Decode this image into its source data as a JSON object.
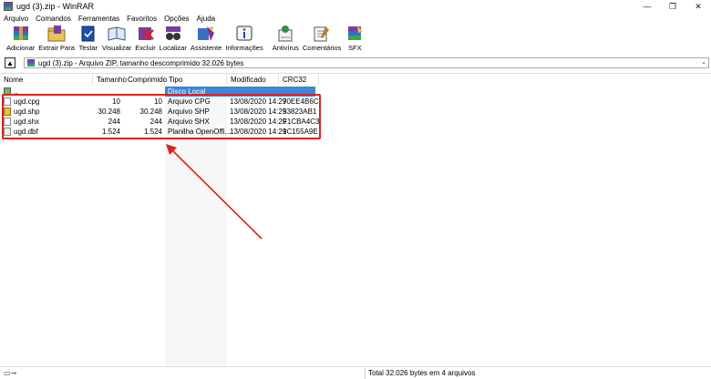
{
  "window": {
    "title": "ugd (3).zip - WinRAR",
    "minimize": "—",
    "restore": "❐",
    "close": "✕"
  },
  "menu": [
    "Arquivo",
    "Comandos",
    "Ferramentas",
    "Favoritos",
    "Opções",
    "Ajuda"
  ],
  "toolbar": {
    "buttons": [
      "Adicionar",
      "Extrair Para",
      "Testar",
      "Visualizar",
      "Excluir",
      "Localizar",
      "Assistente",
      "Informações",
      "Antivírus",
      "Comentários",
      "SFX"
    ]
  },
  "address": {
    "text": "ugd (3).zip - Arquivo ZIP, tamanho descomprimido 32.026 bytes",
    "up_glyph": "▲",
    "dropdown_glyph": "⌄"
  },
  "columns": {
    "name": "Nome",
    "size": "Tamanho",
    "compressed": "Comprimido",
    "type": "Tipo",
    "modified": "Modificado",
    "crc": "CRC32"
  },
  "parent_row": {
    "name": "..",
    "type": "Disco Local"
  },
  "files": [
    {
      "name": "ugd.cpg",
      "size": "10",
      "compressed": "10",
      "type": "Arquivo CPG",
      "modified": "13/08/2020 14:29",
      "crc": "70EE4B6C"
    },
    {
      "name": "ugd.shp",
      "size": "30.248",
      "compressed": "30.248",
      "type": "Arquivo SHP",
      "modified": "13/08/2020 14:29",
      "crc": "53823AB1"
    },
    {
      "name": "ugd.shx",
      "size": "244",
      "compressed": "244",
      "type": "Arquivo SHX",
      "modified": "13/08/2020 14:29",
      "crc": "F1CBA4C3"
    },
    {
      "name": "ugd.dbf",
      "size": "1.524",
      "compressed": "1.524",
      "type": "Planilha OpenOffi...",
      "modified": "13/08/2020 14:29",
      "crc": "1C155A9E"
    }
  ],
  "status": {
    "text": "Total 32.026 bytes em 4 arquivos",
    "icons": "▭⊸"
  },
  "colors": {
    "highlight": "#e02020",
    "selection": "#3a86d8",
    "arrow": "#e02020"
  }
}
